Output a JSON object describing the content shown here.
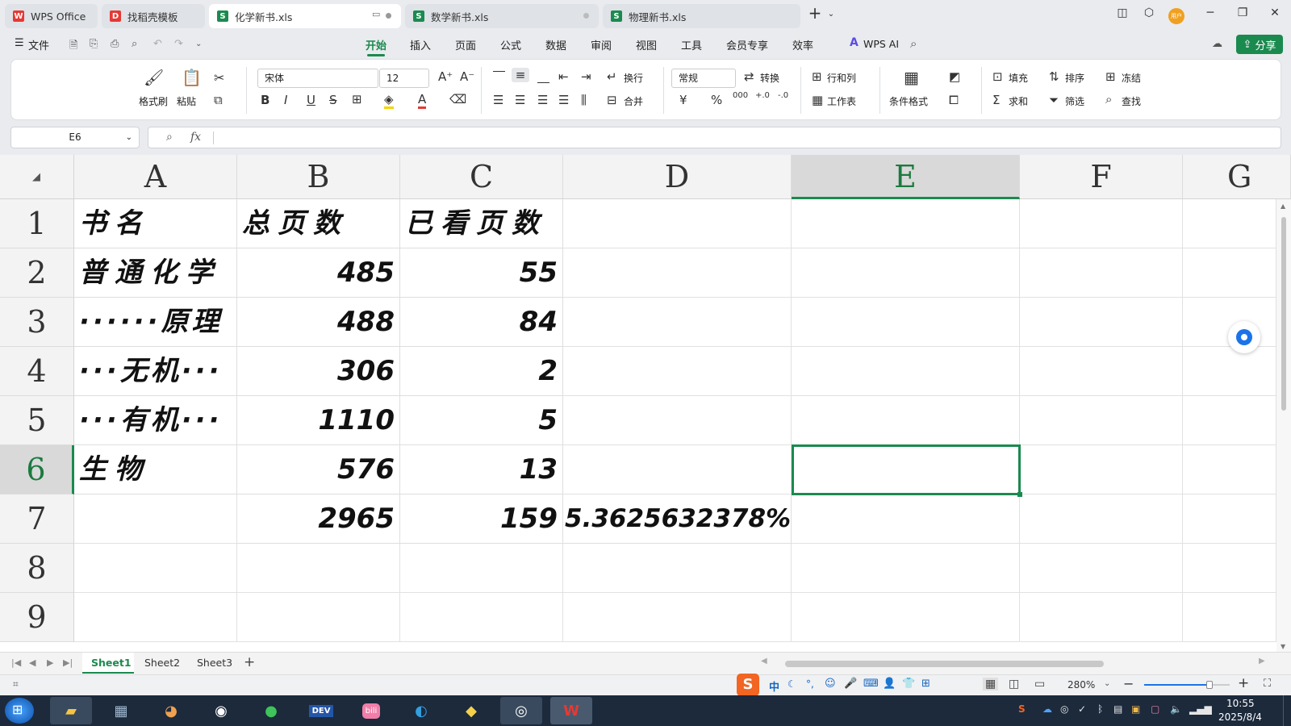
{
  "tabs": [
    {
      "label": "WPS Office"
    },
    {
      "label": "找稻壳模板"
    },
    {
      "label": "化学新书.xls"
    },
    {
      "label": "数学新书.xls"
    },
    {
      "label": "物理新书.xls"
    }
  ],
  "avatar_text": "用户",
  "menu": {
    "file": "文件",
    "items": [
      "开始",
      "插入",
      "页面",
      "公式",
      "数据",
      "审阅",
      "视图",
      "工具",
      "会员专享",
      "效率"
    ],
    "ai": "WPS AI",
    "share": "分享"
  },
  "ribbon": {
    "format_painter": "格式刷",
    "paste": "粘贴",
    "font_name": "宋体",
    "font_size": "12",
    "wrap": "换行",
    "merge": "合并",
    "number_format": "常规",
    "convert": "转换",
    "rows_cols": "行和列",
    "worksheet": "工作表",
    "cond_format": "条件格式",
    "fill": "填充",
    "sort": "排序",
    "freeze": "冻结",
    "sum": "求和",
    "filter": "筛选",
    "find": "查找",
    "bold": "B",
    "italic": "I",
    "underline": "U",
    "strike": "S",
    "currency": "¥",
    "percent": "%"
  },
  "name_box": "E6",
  "fx": "fx",
  "columns": [
    "A",
    "B",
    "C",
    "D",
    "E",
    "F",
    "G"
  ],
  "rows": [
    "1",
    "2",
    "3",
    "4",
    "5",
    "6",
    "7",
    "8",
    "9"
  ],
  "cells": {
    "A1": "书名",
    "B1": "总页数",
    "C1": "已看页数",
    "A2": "普通化学",
    "B2": "485",
    "C2": "55",
    "A3": "······原理",
    "B3": "488",
    "C3": "84",
    "A4": "···无机···",
    "B4": "306",
    "C4": "2",
    "A5": "···有机···",
    "B5": "1110",
    "C5": "5",
    "A6": "生物",
    "B6": "576",
    "C6": "13",
    "B7": "2965",
    "C7": "159",
    "D7": "5.3625632378%"
  },
  "sheets": [
    "Sheet1",
    "Sheet2",
    "Sheet3"
  ],
  "status": {
    "zoom": "280%"
  },
  "clock": {
    "time": "10:55",
    "date": "2025/8/4"
  },
  "colors": {
    "accent": "#1b8a4f",
    "taskbar": "#1c2a3c"
  }
}
